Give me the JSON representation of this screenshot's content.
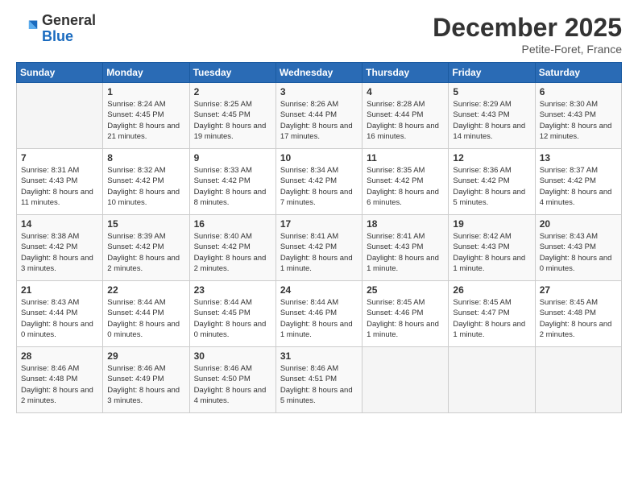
{
  "logo": {
    "general": "General",
    "blue": "Blue"
  },
  "header": {
    "month": "December 2025",
    "location": "Petite-Foret, France"
  },
  "weekdays": [
    "Sunday",
    "Monday",
    "Tuesday",
    "Wednesday",
    "Thursday",
    "Friday",
    "Saturday"
  ],
  "weeks": [
    [
      {
        "day": "",
        "sunrise": "",
        "sunset": "",
        "daylight": ""
      },
      {
        "day": "1",
        "sunrise": "Sunrise: 8:24 AM",
        "sunset": "Sunset: 4:45 PM",
        "daylight": "Daylight: 8 hours and 21 minutes."
      },
      {
        "day": "2",
        "sunrise": "Sunrise: 8:25 AM",
        "sunset": "Sunset: 4:45 PM",
        "daylight": "Daylight: 8 hours and 19 minutes."
      },
      {
        "day": "3",
        "sunrise": "Sunrise: 8:26 AM",
        "sunset": "Sunset: 4:44 PM",
        "daylight": "Daylight: 8 hours and 17 minutes."
      },
      {
        "day": "4",
        "sunrise": "Sunrise: 8:28 AM",
        "sunset": "Sunset: 4:44 PM",
        "daylight": "Daylight: 8 hours and 16 minutes."
      },
      {
        "day": "5",
        "sunrise": "Sunrise: 8:29 AM",
        "sunset": "Sunset: 4:43 PM",
        "daylight": "Daylight: 8 hours and 14 minutes."
      },
      {
        "day": "6",
        "sunrise": "Sunrise: 8:30 AM",
        "sunset": "Sunset: 4:43 PM",
        "daylight": "Daylight: 8 hours and 12 minutes."
      }
    ],
    [
      {
        "day": "7",
        "sunrise": "Sunrise: 8:31 AM",
        "sunset": "Sunset: 4:43 PM",
        "daylight": "Daylight: 8 hours and 11 minutes."
      },
      {
        "day": "8",
        "sunrise": "Sunrise: 8:32 AM",
        "sunset": "Sunset: 4:42 PM",
        "daylight": "Daylight: 8 hours and 10 minutes."
      },
      {
        "day": "9",
        "sunrise": "Sunrise: 8:33 AM",
        "sunset": "Sunset: 4:42 PM",
        "daylight": "Daylight: 8 hours and 8 minutes."
      },
      {
        "day": "10",
        "sunrise": "Sunrise: 8:34 AM",
        "sunset": "Sunset: 4:42 PM",
        "daylight": "Daylight: 8 hours and 7 minutes."
      },
      {
        "day": "11",
        "sunrise": "Sunrise: 8:35 AM",
        "sunset": "Sunset: 4:42 PM",
        "daylight": "Daylight: 8 hours and 6 minutes."
      },
      {
        "day": "12",
        "sunrise": "Sunrise: 8:36 AM",
        "sunset": "Sunset: 4:42 PM",
        "daylight": "Daylight: 8 hours and 5 minutes."
      },
      {
        "day": "13",
        "sunrise": "Sunrise: 8:37 AM",
        "sunset": "Sunset: 4:42 PM",
        "daylight": "Daylight: 8 hours and 4 minutes."
      }
    ],
    [
      {
        "day": "14",
        "sunrise": "Sunrise: 8:38 AM",
        "sunset": "Sunset: 4:42 PM",
        "daylight": "Daylight: 8 hours and 3 minutes."
      },
      {
        "day": "15",
        "sunrise": "Sunrise: 8:39 AM",
        "sunset": "Sunset: 4:42 PM",
        "daylight": "Daylight: 8 hours and 2 minutes."
      },
      {
        "day": "16",
        "sunrise": "Sunrise: 8:40 AM",
        "sunset": "Sunset: 4:42 PM",
        "daylight": "Daylight: 8 hours and 2 minutes."
      },
      {
        "day": "17",
        "sunrise": "Sunrise: 8:41 AM",
        "sunset": "Sunset: 4:42 PM",
        "daylight": "Daylight: 8 hours and 1 minute."
      },
      {
        "day": "18",
        "sunrise": "Sunrise: 8:41 AM",
        "sunset": "Sunset: 4:43 PM",
        "daylight": "Daylight: 8 hours and 1 minute."
      },
      {
        "day": "19",
        "sunrise": "Sunrise: 8:42 AM",
        "sunset": "Sunset: 4:43 PM",
        "daylight": "Daylight: 8 hours and 1 minute."
      },
      {
        "day": "20",
        "sunrise": "Sunrise: 8:43 AM",
        "sunset": "Sunset: 4:43 PM",
        "daylight": "Daylight: 8 hours and 0 minutes."
      }
    ],
    [
      {
        "day": "21",
        "sunrise": "Sunrise: 8:43 AM",
        "sunset": "Sunset: 4:44 PM",
        "daylight": "Daylight: 8 hours and 0 minutes."
      },
      {
        "day": "22",
        "sunrise": "Sunrise: 8:44 AM",
        "sunset": "Sunset: 4:44 PM",
        "daylight": "Daylight: 8 hours and 0 minutes."
      },
      {
        "day": "23",
        "sunrise": "Sunrise: 8:44 AM",
        "sunset": "Sunset: 4:45 PM",
        "daylight": "Daylight: 8 hours and 0 minutes."
      },
      {
        "day": "24",
        "sunrise": "Sunrise: 8:44 AM",
        "sunset": "Sunset: 4:46 PM",
        "daylight": "Daylight: 8 hours and 1 minute."
      },
      {
        "day": "25",
        "sunrise": "Sunrise: 8:45 AM",
        "sunset": "Sunset: 4:46 PM",
        "daylight": "Daylight: 8 hours and 1 minute."
      },
      {
        "day": "26",
        "sunrise": "Sunrise: 8:45 AM",
        "sunset": "Sunset: 4:47 PM",
        "daylight": "Daylight: 8 hours and 1 minute."
      },
      {
        "day": "27",
        "sunrise": "Sunrise: 8:45 AM",
        "sunset": "Sunset: 4:48 PM",
        "daylight": "Daylight: 8 hours and 2 minutes."
      }
    ],
    [
      {
        "day": "28",
        "sunrise": "Sunrise: 8:46 AM",
        "sunset": "Sunset: 4:48 PM",
        "daylight": "Daylight: 8 hours and 2 minutes."
      },
      {
        "day": "29",
        "sunrise": "Sunrise: 8:46 AM",
        "sunset": "Sunset: 4:49 PM",
        "daylight": "Daylight: 8 hours and 3 minutes."
      },
      {
        "day": "30",
        "sunrise": "Sunrise: 8:46 AM",
        "sunset": "Sunset: 4:50 PM",
        "daylight": "Daylight: 8 hours and 4 minutes."
      },
      {
        "day": "31",
        "sunrise": "Sunrise: 8:46 AM",
        "sunset": "Sunset: 4:51 PM",
        "daylight": "Daylight: 8 hours and 5 minutes."
      },
      {
        "day": "",
        "sunrise": "",
        "sunset": "",
        "daylight": ""
      },
      {
        "day": "",
        "sunrise": "",
        "sunset": "",
        "daylight": ""
      },
      {
        "day": "",
        "sunrise": "",
        "sunset": "",
        "daylight": ""
      }
    ]
  ]
}
